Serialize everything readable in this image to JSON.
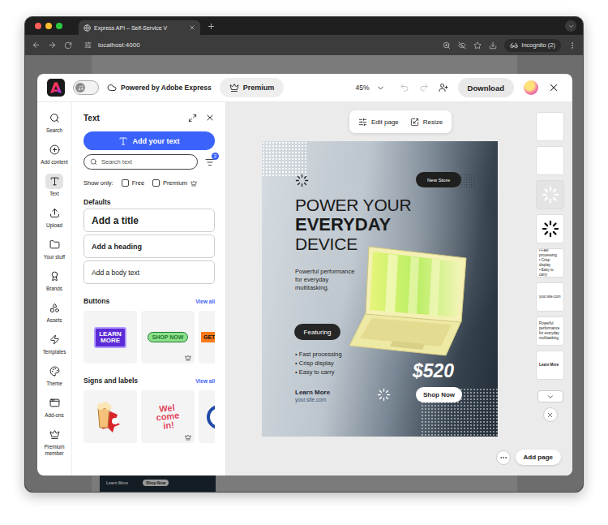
{
  "browser": {
    "tab_title": "Express API – Self-Service V",
    "url": "localhost:4000",
    "profile": "Incognito (2)"
  },
  "header": {
    "toggle_on": false,
    "powered_by": "Powered by Adobe Express",
    "premium": "Premium",
    "zoom": "45%",
    "undo_disabled": true,
    "redo_disabled": true,
    "download": "Download"
  },
  "rail": [
    {
      "label": "Search",
      "selected": false
    },
    {
      "label": "Add content",
      "selected": false
    },
    {
      "label": "Text",
      "selected": true
    },
    {
      "label": "Upload",
      "selected": false
    },
    {
      "label": "Your stuff",
      "selected": false
    },
    {
      "label": "Brands",
      "selected": false
    },
    {
      "label": "Assets",
      "selected": false
    },
    {
      "label": "Templates",
      "selected": false
    },
    {
      "label": "Theme",
      "selected": false
    },
    {
      "label": "Add-ons",
      "selected": false
    },
    {
      "label": "Premium member",
      "selected": false
    }
  ],
  "panel": {
    "title": "Text",
    "add_button": "Add your text",
    "search_placeholder": "Search text",
    "filter_count": "2",
    "show_only_label": "Show only:",
    "filters": [
      {
        "label": "Free",
        "checked": false,
        "premium": false
      },
      {
        "label": "Premium",
        "checked": false,
        "premium": true
      }
    ],
    "defaults_title": "Defaults",
    "defaults": [
      {
        "label": "Add a title",
        "kind": "title"
      },
      {
        "label": "Add a heading",
        "kind": "heading"
      },
      {
        "label": "Add a body text",
        "kind": "body"
      }
    ],
    "sections": [
      {
        "title": "Buttons",
        "view_all": "View all",
        "items": [
          {
            "kind": "purple",
            "text": "LEARN MORE",
            "premium": false
          },
          {
            "kind": "green",
            "text": "SHOP NOW",
            "premium": true
          },
          {
            "kind": "orange",
            "text": "GET",
            "premium": false
          }
        ]
      },
      {
        "title": "Signs and labels",
        "view_all": "View all",
        "items": [
          {
            "kind": "popcorn",
            "premium": false
          },
          {
            "kind": "welcome",
            "text": "Wel come in!",
            "premium": true
          },
          {
            "kind": "badge",
            "premium": false
          }
        ]
      }
    ]
  },
  "canvas_toolbar": [
    {
      "label": "Edit page"
    },
    {
      "label": "Resize"
    }
  ],
  "poster": {
    "badge": "New Store",
    "headline": [
      {
        "text": "POWER YOUR",
        "kind": "light"
      },
      {
        "text": "EVERYDAY",
        "kind": "bold"
      },
      {
        "text": "DEVICE",
        "kind": "light"
      }
    ],
    "tagline": "Powerful performance for everyday multitasking.",
    "featuring": "Featuring",
    "bullets": [
      "• Fast processing",
      "• Crisp display",
      "• Easy to carry"
    ],
    "price": "$520",
    "cta": "Shop Now",
    "link_label": "Learn More",
    "site": "your.site.com"
  },
  "page_thumbnails": [
    {
      "kind": "blank",
      "lines": []
    },
    {
      "kind": "blank",
      "lines": []
    },
    {
      "kind": "spinner-light",
      "lines": []
    },
    {
      "kind": "spinner-dark",
      "lines": []
    },
    {
      "kind": "text",
      "lines": [
        "• Fast processing",
        "• Crisp display",
        "• Easy to carry"
      ]
    },
    {
      "kind": "text",
      "lines": [
        "your.site.com"
      ]
    },
    {
      "kind": "text",
      "lines": [
        "Powerful performance for everyday multitasking."
      ]
    },
    {
      "kind": "bold",
      "lines": [
        "Learn More"
      ]
    }
  ],
  "footer": {
    "add_page": "Add page"
  },
  "background_page": {
    "texts": [
      "Learn More",
      "Shop Now"
    ]
  }
}
